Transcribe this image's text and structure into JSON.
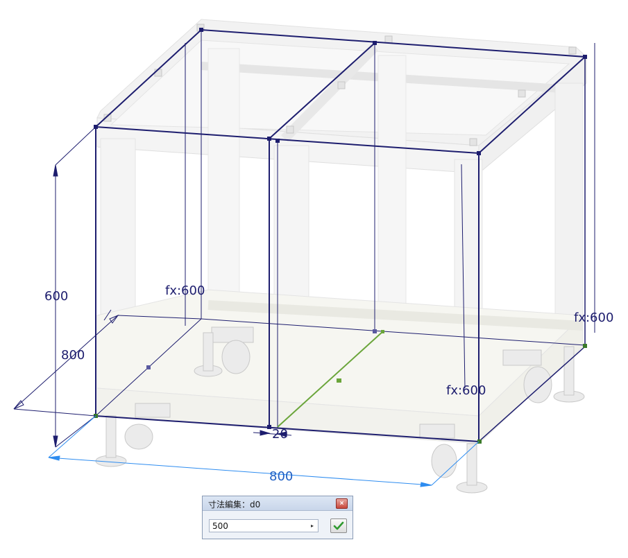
{
  "viewport": {
    "dimensions": {
      "height_main": "600",
      "depth_left": "800",
      "fx_center": "fx:600",
      "fx_right_front": "fx:600",
      "fx_right_back": "fx:600",
      "gap": "20",
      "width_bottom": "800"
    }
  },
  "dialog": {
    "title": "寸法編集：d0",
    "close_symbol": "×",
    "value": "500",
    "arrow_symbol": "▸",
    "ok_icon": "check-icon"
  },
  "colors": {
    "sketch_line": "#1d1d6e",
    "selected_line": "#6aa53a",
    "dimension_blue": "#2d8cf0"
  }
}
